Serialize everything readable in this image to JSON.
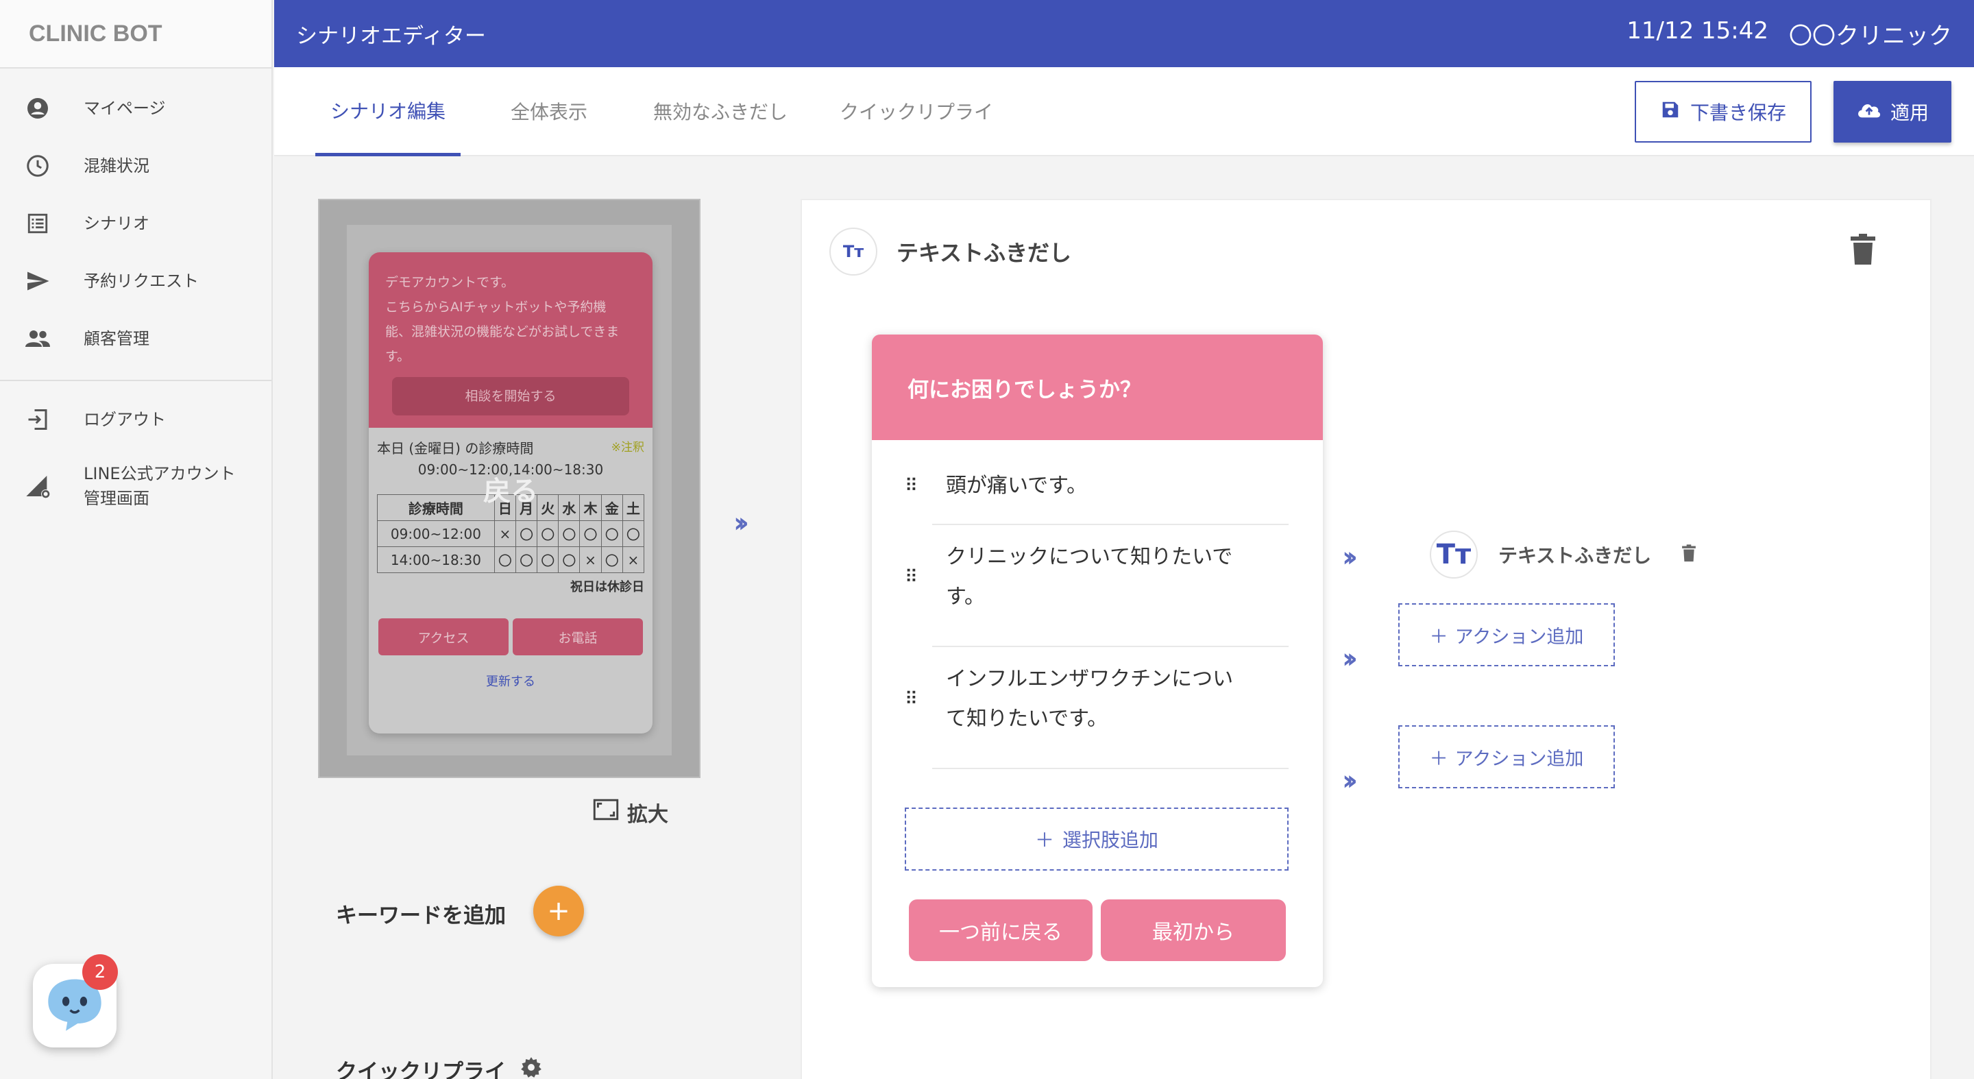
{
  "brand": "CLINIC BOT",
  "sidebar": {
    "items": [
      {
        "label": "マイページ",
        "icon": "account-circle-icon"
      },
      {
        "label": "混雑状況",
        "icon": "clock-icon"
      },
      {
        "label": "シナリオ",
        "icon": "list-icon"
      },
      {
        "label": "予約リクエスト",
        "icon": "send-icon"
      },
      {
        "label": "顧客管理",
        "icon": "people-icon"
      }
    ],
    "secondary": [
      {
        "label": "ログアウト",
        "icon": "logout-icon"
      },
      {
        "label_line1": "LINE公式アカウント",
        "label_line2": "管理画面",
        "icon": "line-admin-icon"
      }
    ]
  },
  "header": {
    "title": "シナリオエディター",
    "datetime": "11/12 15:42",
    "clinic": "〇〇クリニック"
  },
  "tabs": [
    {
      "label": "シナリオ編集",
      "active": true
    },
    {
      "label": "全体表示",
      "active": false
    },
    {
      "label": "無効なふきだし",
      "active": false
    },
    {
      "label": "クイックリプライ",
      "active": false
    }
  ],
  "toolbar": {
    "save_label": "下書き保存",
    "apply_label": "適用"
  },
  "preview": {
    "intro_line1": "デモアカウントです。",
    "intro_line2": "こちらからAIチャットボットや予約機",
    "intro_line3": "能、混雑状況の機能などがお試しできま",
    "intro_line4": "す。",
    "start_button": "相談を開始する",
    "hours_title": "本日 (金曜日) の診療時間",
    "note": "※注釈",
    "today_times": "09:00~12:00,14:00~18:30",
    "back_overlay": "戻る",
    "schedule": {
      "header": [
        "診療時間",
        "日",
        "月",
        "火",
        "水",
        "木",
        "金",
        "土"
      ],
      "rows": [
        [
          "09:00~12:00",
          "×",
          "〇",
          "〇",
          "〇",
          "〇",
          "〇",
          "〇"
        ],
        [
          "14:00~18:30",
          "〇",
          "〇",
          "〇",
          "〇",
          "×",
          "〇",
          "×"
        ]
      ]
    },
    "holiday": "祝日は休診日",
    "access_button": "アクセス",
    "phone_button": "お電話",
    "update_link": "更新する",
    "zoom_label": "拡大"
  },
  "keyword": {
    "label": "キーワードを追加",
    "add": "+"
  },
  "quick_reply": {
    "label": "クイックリプライ"
  },
  "editor": {
    "type_label": "テキストふきだし",
    "type_icon_text": "Tт",
    "bubble_title": "何にお困りでしょうか？",
    "choices": [
      {
        "line1": "頭が痛いです。",
        "line2": ""
      },
      {
        "line1": "クリニックについて知りたいで",
        "line2": "す。"
      },
      {
        "line1": "インフルエンザワクチンについ",
        "line2": "て知りたいです。"
      }
    ],
    "add_choice": "選択肢追加",
    "back_one": "一つ前に戻る",
    "from_start": "最初から",
    "actions": [
      {
        "label": "テキストふきだし",
        "icon_text": "Tт"
      },
      {
        "label": "アクション追加"
      },
      {
        "label": "アクション追加"
      }
    ]
  },
  "chatbot": {
    "badge_count": "2"
  },
  "colors": {
    "primary": "#3f51b5",
    "pink": "#ee809c",
    "orange": "#f09b3a",
    "badge": "#e84a4a"
  }
}
